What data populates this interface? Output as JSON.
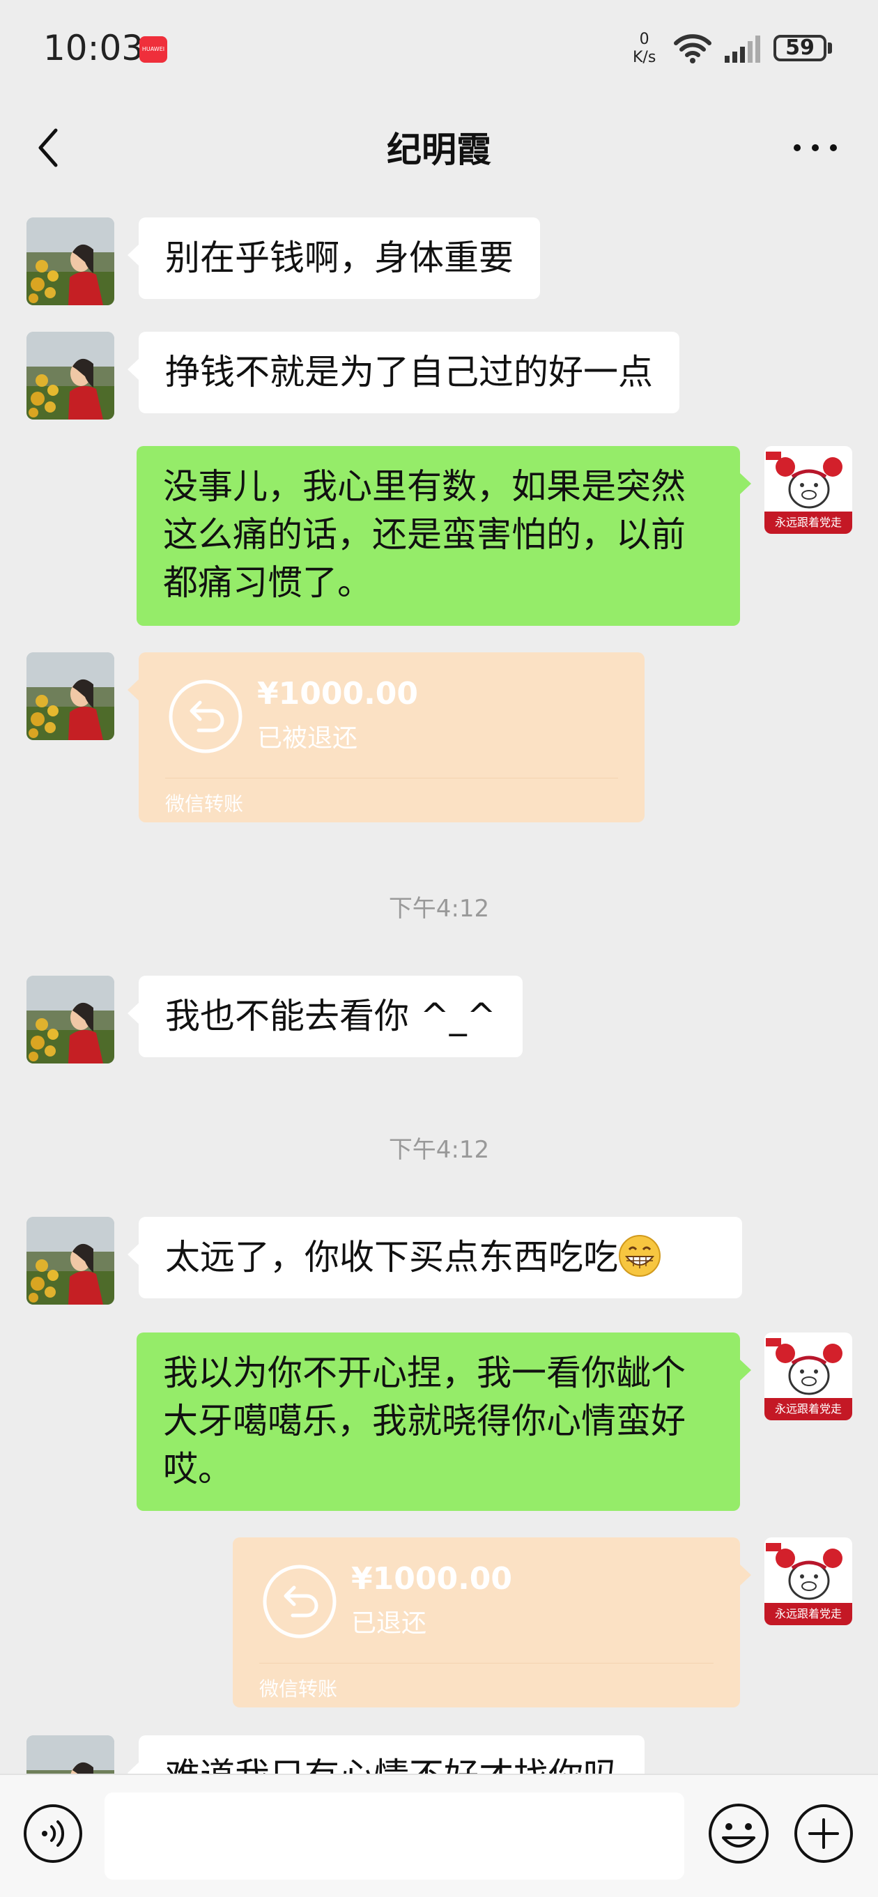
{
  "status_bar": {
    "time": "10:03",
    "notif_app": "HUAWEI",
    "net_speed_value": "0",
    "net_speed_unit": "K/s",
    "battery": "59"
  },
  "header": {
    "title": "纪明霞"
  },
  "messages": [
    {
      "side": "left",
      "type": "text",
      "text": "别在乎钱啊，身体重要"
    },
    {
      "side": "left",
      "type": "text",
      "text": "挣钱不就是为了自己过的好一点"
    },
    {
      "side": "right",
      "type": "text",
      "lines": [
        "没事儿，我心里有数，如果是突然",
        "这么痛的话，还是蛮害怕的，以前",
        "都痛习惯了。"
      ]
    },
    {
      "side": "left",
      "type": "transfer",
      "amount": "¥1000.00",
      "status": "已被退还",
      "label": "微信转账"
    },
    {
      "type": "timestamp",
      "text": "下午4:12"
    },
    {
      "side": "left",
      "type": "text",
      "text": "我也不能去看你 ^_^"
    },
    {
      "type": "timestamp",
      "text": "下午4:12"
    },
    {
      "side": "left",
      "type": "text",
      "text": "太远了，你收下买点东西吃吃",
      "emoji": "grin-emoji"
    },
    {
      "side": "right",
      "type": "text",
      "lines": [
        "我以为你不开心捏，我一看你龇个",
        "大牙噶噶乐，我就晓得你心情蛮好",
        "哎。"
      ]
    },
    {
      "side": "right",
      "type": "transfer",
      "amount": "¥1000.00",
      "status": "已退还",
      "label": "微信转账"
    },
    {
      "side": "left",
      "type": "text",
      "text": "难道我只有心情不好才找你吗"
    }
  ],
  "self_avatar_text": "永远跟着党走",
  "icons": {
    "back": "back-arrow-icon",
    "more": "more-dots-icon",
    "voice": "voice-icon",
    "emoji": "emoji-icon",
    "plus": "plus-icon"
  },
  "colors": {
    "background": "#ededed",
    "bubble_self": "#95ec69",
    "bubble_other": "#ffffff",
    "transfer": "#fbe1c4"
  }
}
